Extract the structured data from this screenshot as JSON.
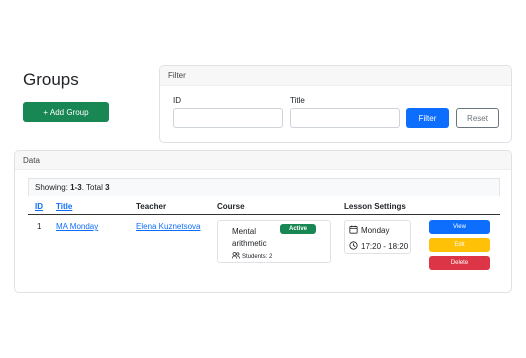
{
  "page": {
    "title": "Groups",
    "add_button": "+ Add Group"
  },
  "filter": {
    "header": "Filter",
    "id_label": "ID",
    "id_value": "",
    "title_label": "Title",
    "title_value": "",
    "filter_button": "Filter",
    "reset_button": "Reset"
  },
  "data": {
    "header": "Data",
    "summary": {
      "prefix": "Showing: ",
      "range": "1-3",
      "total_label": ". Total ",
      "total": "3"
    },
    "columns": {
      "id": "ID",
      "title": "Title",
      "teacher": "Teacher",
      "course": "Course",
      "lesson_settings": "Lesson Settings"
    },
    "rows": [
      {
        "id": "1",
        "title": "MA Monday",
        "teacher": "Elena Kuznetsova",
        "course_name": "Mental arithmetic",
        "course_status": "Active",
        "students": "Students: 2",
        "day": "Monday",
        "time": "17:20 - 18:20",
        "view": "View",
        "edit": "Edit",
        "delete": "Delete"
      }
    ]
  },
  "colors": {
    "primary": "#0d6efd",
    "success": "#198754",
    "warning": "#ffc107",
    "danger": "#dc3545"
  }
}
